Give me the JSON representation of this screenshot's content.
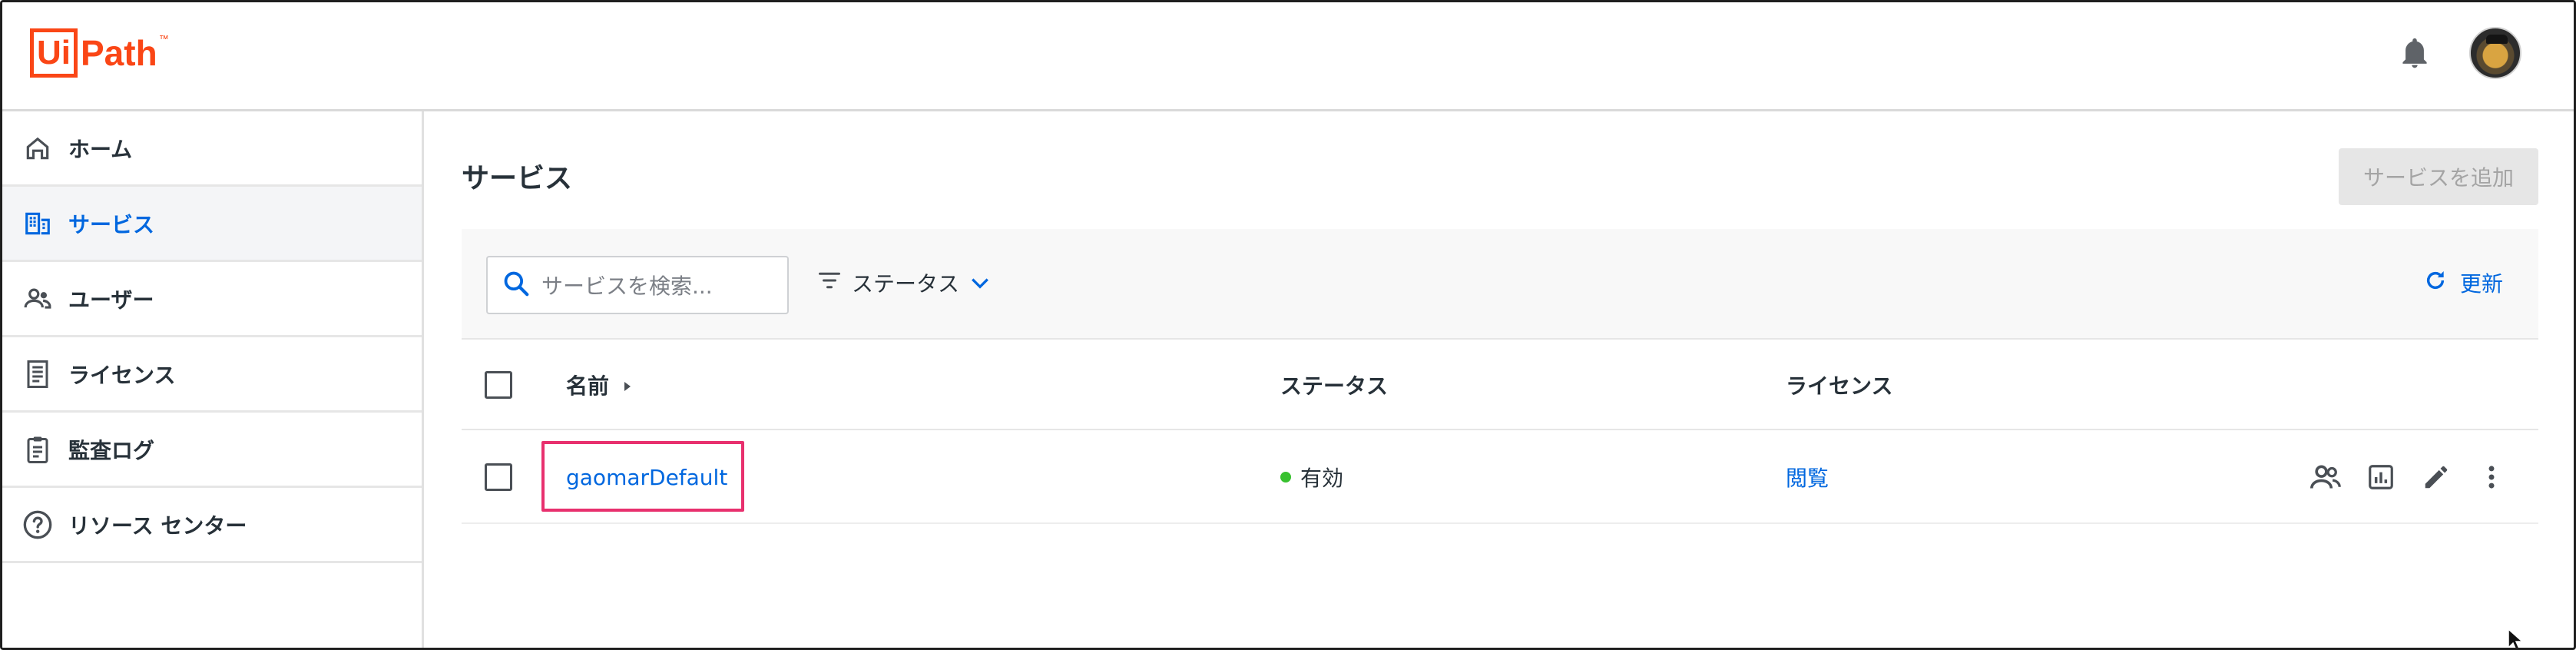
{
  "brand": {
    "logo_box_text": "Ui",
    "logo_text": "Path",
    "logo_tm": "™"
  },
  "header": {
    "notification_icon": "bell-icon",
    "avatar_icon": "user-avatar"
  },
  "sidebar": {
    "items": [
      {
        "label": "ホーム",
        "icon": "home-icon",
        "active": false
      },
      {
        "label": "サービス",
        "icon": "building-icon",
        "active": true
      },
      {
        "label": "ユーザー",
        "icon": "users-icon",
        "active": false
      },
      {
        "label": "ライセンス",
        "icon": "license-icon",
        "active": false
      },
      {
        "label": "監査ログ",
        "icon": "clipboard-icon",
        "active": false
      },
      {
        "label": "リソース センター",
        "icon": "help-icon",
        "active": false
      }
    ]
  },
  "main": {
    "title": "サービス",
    "add_button": "サービスを追加",
    "search": {
      "placeholder": "サービスを検索..."
    },
    "filter_label": "ステータス",
    "refresh_label": "更新"
  },
  "table": {
    "columns": [
      "名前",
      "ステータス",
      "ライセンス"
    ],
    "rows": [
      {
        "name": "gaomarDefault",
        "status": "有効",
        "license": "閲覧"
      }
    ]
  },
  "colors": {
    "accent": "#0067df",
    "brand": "#fa4616",
    "status_active": "#38c12f",
    "highlight": "#e8306e"
  }
}
